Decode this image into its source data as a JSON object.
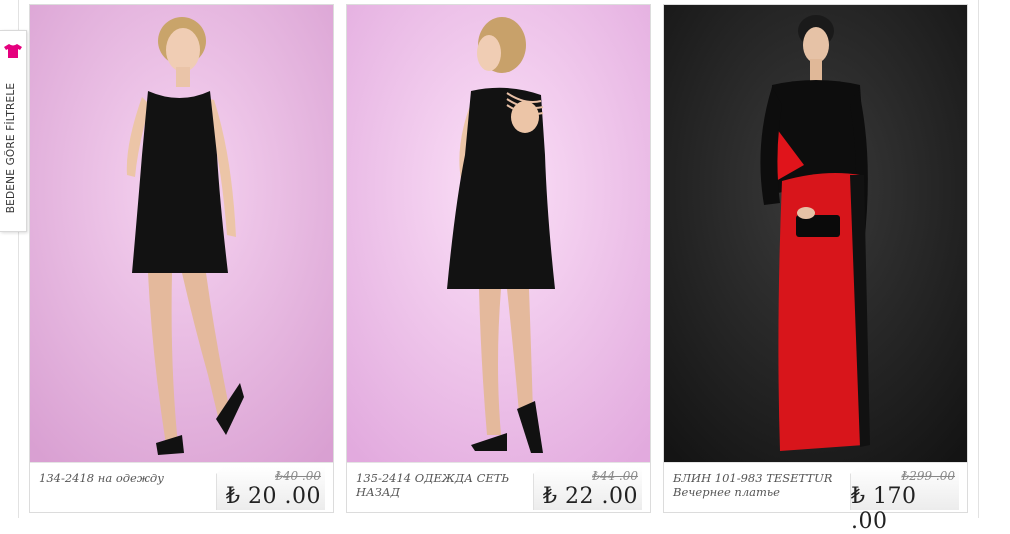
{
  "filter": {
    "label": "BEDENE GÖRE FİLTRELE",
    "icon": "shirt-icon",
    "icon_color": "#e5007e"
  },
  "products": [
    {
      "name": "134-2418 на одежду",
      "old_price": "₺40 .00",
      "price": "₺ 20 .00",
      "background": "#e8b8e0"
    },
    {
      "name": "135-2414 ОДЕЖДА СЕТЬ НАЗАД",
      "old_price": "₺44 .00",
      "price": "₺ 22 .00",
      "background": "#efc3ea"
    },
    {
      "name": "БЛИН 101-983 TESETTUR Вечернее платье",
      "old_price": "₺299 .00",
      "price": "₺ 170 .00",
      "background": "#1f1f1f"
    }
  ]
}
